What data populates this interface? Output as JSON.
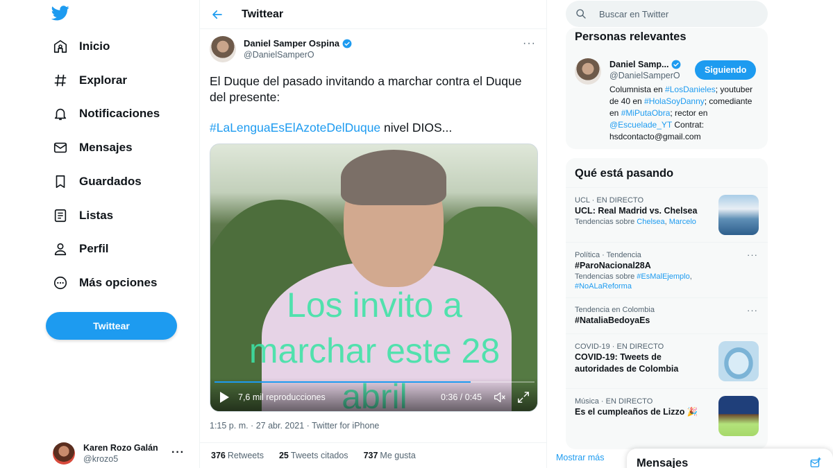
{
  "sidebar": {
    "nav": [
      {
        "label": "Inicio",
        "icon": "home-icon"
      },
      {
        "label": "Explorar",
        "icon": "hashtag-icon"
      },
      {
        "label": "Notificaciones",
        "icon": "bell-icon"
      },
      {
        "label": "Mensajes",
        "icon": "envelope-icon"
      },
      {
        "label": "Guardados",
        "icon": "bookmark-icon"
      },
      {
        "label": "Listas",
        "icon": "list-icon"
      },
      {
        "label": "Perfil",
        "icon": "person-icon"
      },
      {
        "label": "Más opciones",
        "icon": "more-circle-icon"
      }
    ],
    "tweet_button": "Twittear",
    "account": {
      "name": "Karen Rozo Galán",
      "handle": "@krozo5",
      "more": "···"
    }
  },
  "main": {
    "header_title": "Twittear",
    "author": {
      "name": "Daniel Samper Ospina",
      "handle": "@DanielSamperO",
      "verified": true
    },
    "text_line1": "El Duque del pasado invitando a marchar contra el Duque del presente:",
    "hashtag": "#LaLenguaEsElAzoteDelDuque",
    "text_line2": " nivel DIOS...",
    "video": {
      "overlay_lines": [
        "Los invito a",
        "marchar este 28",
        "abril"
      ],
      "views": "7,6 mil reproducciones",
      "time": "0:36 / 0:45",
      "progress": 0.8
    },
    "meta": "1:15 p. m. · 27 abr. 2021 · Twitter for iPhone",
    "stats": [
      {
        "count": "376",
        "label": "Retweets"
      },
      {
        "count": "25",
        "label": "Tweets citados"
      },
      {
        "count": "737",
        "label": "Me gusta"
      }
    ]
  },
  "right": {
    "search_placeholder": "Buscar en Twitter",
    "relevant": {
      "title": "Personas relevantes",
      "name": "Daniel Samp...",
      "handle": "@DanielSamperO",
      "follow_label": "Siguiendo",
      "bio_parts": [
        {
          "t": "Columnista en ",
          "link": false
        },
        {
          "t": "#LosDanieles",
          "link": true
        },
        {
          "t": "; youtuber de 40 en ",
          "link": false
        },
        {
          "t": "#HolaSoyDanny",
          "link": true
        },
        {
          "t": "; comediante en ",
          "link": false
        },
        {
          "t": "#MiPutaObra",
          "link": true
        },
        {
          "t": "; rector en ",
          "link": false
        },
        {
          "t": "@Escuelade_YT",
          "link": true
        },
        {
          "t": " Contrat: hsdcontacto@gmail.com",
          "link": false
        }
      ]
    },
    "trends_title": "Qué está pasando",
    "trends": [
      {
        "meta": "UCL · EN DIRECTO",
        "title": "UCL: Real Madrid vs. Chelsea",
        "sub": "Tendencias sobre ",
        "links": [
          "Chelsea",
          "Marcelo"
        ],
        "thumb": true
      },
      {
        "meta": "Política · Tendencia",
        "title": "#ParoNacional28A",
        "sub": "Tendencias sobre ",
        "links": [
          "#EsMalEjemplo",
          "#NoALaReforma"
        ],
        "more": "···"
      },
      {
        "meta": "Tendencia en Colombia",
        "title": "#NataliaBedoyaEs",
        "more": "···"
      },
      {
        "meta": "COVID-19 · EN DIRECTO",
        "title": "COVID-19: Tweets de autoridades de Colombia",
        "thumb": true
      },
      {
        "meta": "Música · EN DIRECTO",
        "title": "Es el cumpleaños de Lizzo 🎉",
        "thumb": true
      }
    ],
    "show_more": "Mostrar más"
  },
  "dm": {
    "title": "Mensajes"
  },
  "colors": {
    "accent": "#1d9bf0",
    "overlay_text": "#3de3a6",
    "text": "#0f1419",
    "muted": "#536471"
  }
}
